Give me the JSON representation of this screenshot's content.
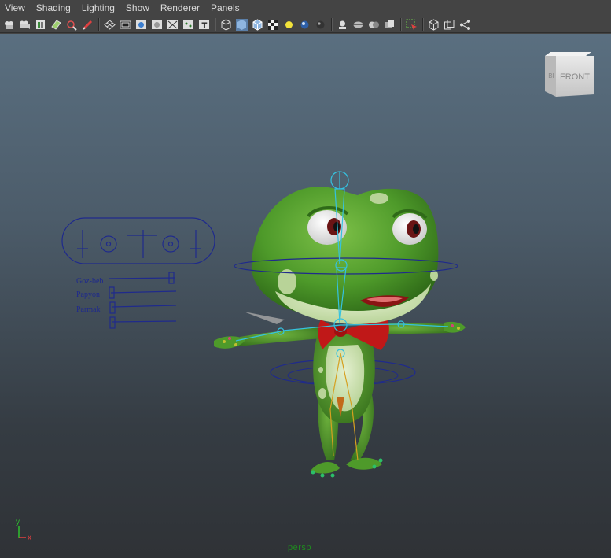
{
  "menubar": {
    "items": [
      "View",
      "Shading",
      "Lighting",
      "Show",
      "Renderer",
      "Panels"
    ]
  },
  "toolbar": {
    "groups": [
      [
        "camera-attr-icon",
        "camera-icon",
        "bookmark-icon",
        "image-plane-icon",
        "2d-pan-zoom-icon",
        "grease-pencil-icon"
      ],
      [
        "grid-icon",
        "film-gate-icon",
        "resolution-gate-icon",
        "gate-mask-icon",
        "field-chart-icon",
        "safe-action-icon",
        "safe-title-icon"
      ],
      [
        "wireframe-icon",
        "smooth-shade-icon",
        "wireframe-on-shaded-icon",
        "textured-icon",
        "lights-icon",
        "shadows-icon",
        "high-quality-icon"
      ],
      [
        "xray-icon",
        "xray-joints-icon",
        "xray-active-icon",
        "backface-culling-icon"
      ],
      [
        "isolate-select-icon"
      ],
      [
        "screen-space-ao-icon",
        "motion-blur-icon",
        "multisample-icon"
      ]
    ]
  },
  "viewcube": {
    "front_label": "FRONT",
    "side_label": "BI"
  },
  "rig_ui": {
    "sliders": [
      {
        "label": "Goz-beb",
        "value": 1.0
      },
      {
        "label": "Papyon",
        "value": 0.0
      },
      {
        "label": "Parmak",
        "value": 0.0
      },
      {
        "label": "",
        "value": 0.0
      }
    ]
  },
  "axis": {
    "y_label": "y",
    "x_label": "x"
  },
  "camera_label": "persp",
  "colors": {
    "menubar_bg": "#444444",
    "viewport_top": "#5a6f80",
    "viewport_bottom": "#2f3236",
    "control_curve": "#1f2a8c",
    "joint": "#35c2e0",
    "frog_green": "#4e9a2a",
    "bowtie_red": "#c01818",
    "camera_label": "#1f8a1f"
  }
}
